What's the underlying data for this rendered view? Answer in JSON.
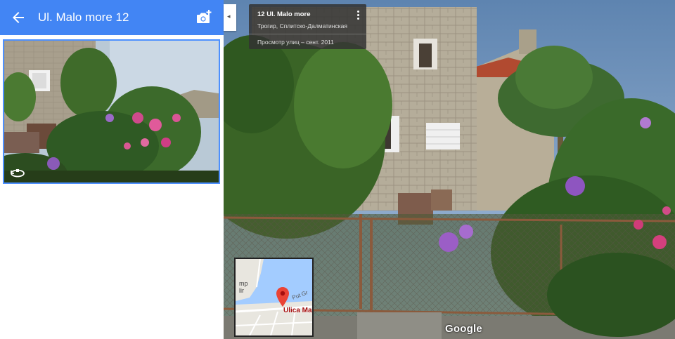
{
  "header": {
    "title": "Ul. Malo more 12",
    "back_icon": "arrow-left-icon",
    "camera_icon": "add-photo-icon",
    "color": "#4285f4"
  },
  "thumbnail": {
    "rotate_icon": "360-rotate-icon",
    "border_color": "#4d90fe"
  },
  "info_card": {
    "title": "12 Ul. Malo more",
    "subtitle": "Трогир, Сплитско-Далматинская",
    "date": "Просмотр улиц – сент. 2011",
    "menu_icon": "more-vert-icon"
  },
  "minimap": {
    "place_label": "Ulica Ma",
    "road_label": "Put Gr",
    "edge_text": "mp\nlir",
    "pin_icon": "map-pin-icon"
  },
  "collapse": {
    "arrow": "◂"
  },
  "google_logo": "Google"
}
